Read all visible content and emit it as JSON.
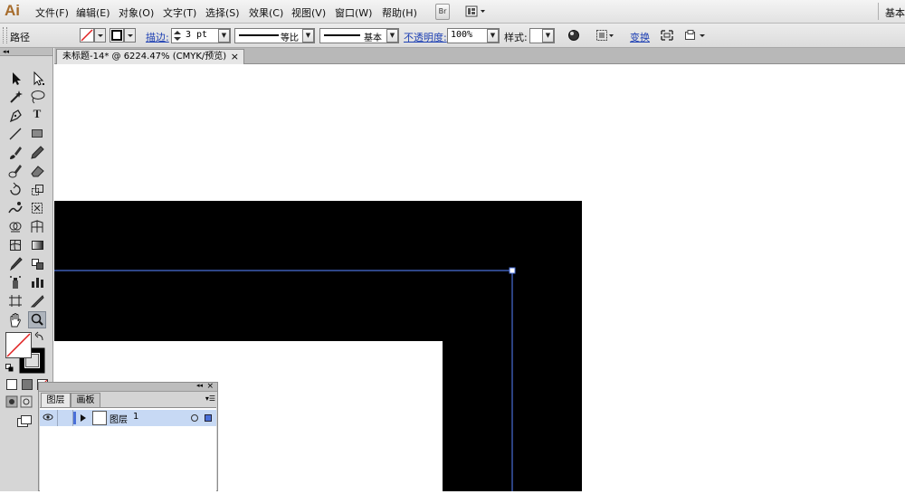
{
  "app": {
    "logo": "Ai"
  },
  "menu": [
    {
      "label": "文件(F)"
    },
    {
      "label": "编辑(E)"
    },
    {
      "label": "对象(O)"
    },
    {
      "label": "文字(T)"
    },
    {
      "label": "选择(S)"
    },
    {
      "label": "效果(C)"
    },
    {
      "label": "视图(V)"
    },
    {
      "label": "窗口(W)"
    },
    {
      "label": "帮助(H)"
    }
  ],
  "bridge_button": "Br",
  "workspace_label": "基本",
  "control": {
    "selection_type": "路径",
    "stroke_label": "描边:",
    "stroke_weight": "3 pt",
    "profile_label": "等比",
    "brush_label": "基本",
    "opacity_label": "不透明度:",
    "opacity_value": "100%",
    "style_label": "样式:",
    "transform_label": "变换"
  },
  "document_tab": {
    "title": "未标题-14* @ 6224.47% (CMYK/预览)",
    "close": "×"
  },
  "tools": {
    "selection": "selection-icon",
    "direct_selection": "direct-selection-icon",
    "magic_wand": "magic-wand-icon",
    "lasso": "lasso-icon",
    "pen": "pen-icon",
    "type": "T",
    "line": "line-segment-icon",
    "rectangle": "rectangle-icon",
    "paintbrush": "paintbrush-icon",
    "pencil": "pencil-icon",
    "blob_brush": "blob-brush-icon",
    "eraser": "eraser-icon",
    "rotate": "rotate-icon",
    "scale": "scale-icon",
    "warp": "warp-icon",
    "free_transform": "free-transform-icon",
    "shape_builder": "shape-builder-icon",
    "perspective_grid": "perspective-grid-icon",
    "mesh": "mesh-icon",
    "gradient": "gradient-icon",
    "eyedropper": "eyedropper-icon",
    "blend": "blend-icon",
    "symbol_sprayer": "symbol-sprayer-icon",
    "column_graph": "column-graph-icon",
    "artboard": "artboard-icon",
    "slice": "slice-icon",
    "hand": "hand-icon",
    "zoom": "zoom-icon"
  },
  "colors": {
    "selection_path": "#4a6fd8",
    "artwork_fill": "#000000",
    "fill_none_slash": "#e02020",
    "link_blue": "#1d3fb3"
  },
  "layers_panel": {
    "tabs": [
      {
        "label": "图层"
      },
      {
        "label": "画板"
      }
    ],
    "rows": [
      {
        "name": "图层",
        "number": "1"
      }
    ]
  }
}
